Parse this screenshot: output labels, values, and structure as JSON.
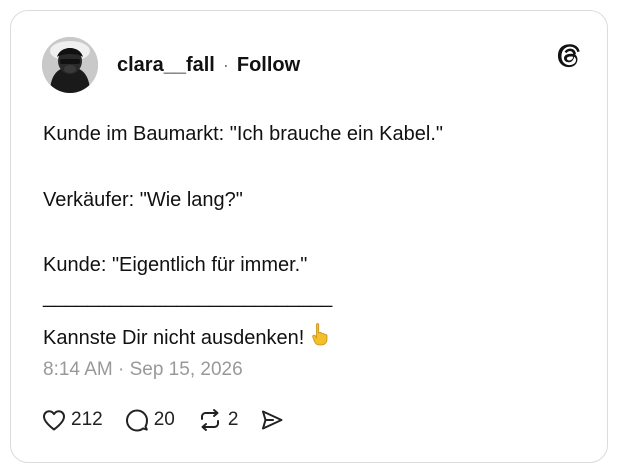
{
  "post": {
    "username": "clara__fall",
    "separator": "·",
    "follow_label": "Follow",
    "lines": [
      "Kunde im Baumarkt: \"Ich brauche ein Kabel.\"",
      "Verkäufer: \"Wie lang?\"",
      "Kunde: \"Eigentlich für immer.\"",
      "__________________________",
      "Kannste Dir nicht ausdenken!"
    ],
    "timestamp": "8:14 AM · Sep 15, 2026"
  },
  "actions": {
    "likes": "212",
    "replies": "20",
    "reposts": "2"
  },
  "icons": {
    "logo": "threads-logo-icon",
    "emoji": "pointing-up-emoji",
    "like": "heart-icon",
    "reply": "comment-icon",
    "repost": "repost-icon",
    "share": "send-icon"
  },
  "colors": {
    "text": "#111111",
    "muted": "#999999",
    "border": "#dcdcdc",
    "emoji": "#f4c02a"
  }
}
